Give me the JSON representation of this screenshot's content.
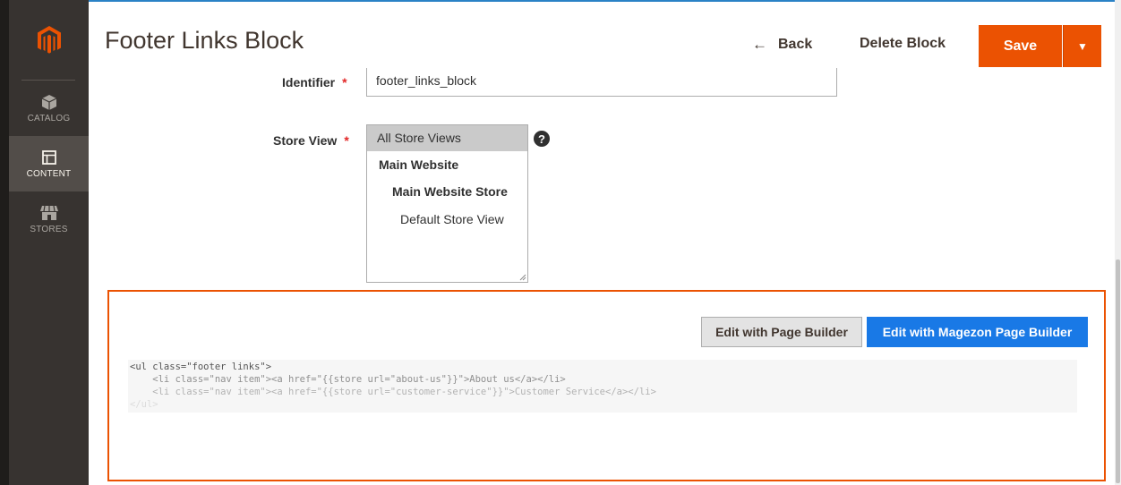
{
  "nav": {
    "items": [
      {
        "label": "CATALOG",
        "icon": "cube-icon"
      },
      {
        "label": "CONTENT",
        "icon": "layout-icon",
        "active": true
      },
      {
        "label": "STORES",
        "icon": "store-icon"
      }
    ]
  },
  "header": {
    "title": "Footer Links Block",
    "back_label": "Back",
    "delete_label": "Delete Block",
    "save_label": "Save"
  },
  "form": {
    "identifier_label": "Identifier",
    "identifier_value": "footer_links_block",
    "store_view_label": "Store View",
    "store_options": [
      {
        "label": "All Store Views",
        "selected": true
      },
      {
        "label": "Main Website",
        "bold": true
      },
      {
        "label": "Main Website Store",
        "bold": true
      },
      {
        "label": "Default Store View"
      }
    ]
  },
  "editor": {
    "page_builder_label": "Edit with Page Builder",
    "magezon_label": "Edit with Magezon Page Builder",
    "code_lines": [
      "<ul class=\"footer links\">",
      "    <li class=\"nav item\"><a href=\"{{store url=\"about-us\"}}\">About us</a></li>",
      "    <li class=\"nav item\"><a href=\"{{store url=\"customer-service\"}}\">Customer Service</a></li>",
      "</ul>"
    ]
  },
  "colors": {
    "accent": "#eb5202",
    "magezon_blue": "#1979e6",
    "sidebar": "#373330"
  }
}
